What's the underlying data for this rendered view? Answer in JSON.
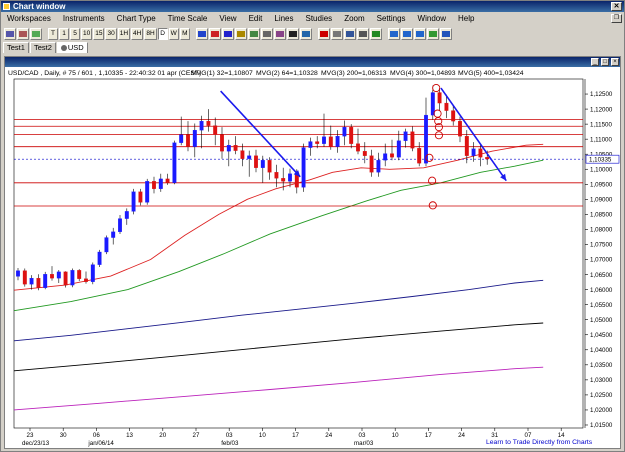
{
  "window": {
    "title": "Chart window"
  },
  "menu": [
    "Workspaces",
    "Instruments",
    "Chart Type",
    "Time Scale",
    "View",
    "Edit",
    "Lines",
    "Studies",
    "Zoom",
    "Settings",
    "Window",
    "Help"
  ],
  "toolbar": {
    "timeframes": [
      "T",
      "1",
      "5",
      "10",
      "15",
      "30",
      "1H",
      "4H",
      "8H",
      "D",
      "W",
      "M"
    ],
    "active_timeframe": "D"
  },
  "tabs": [
    "Test1",
    "Test2",
    "USD"
  ],
  "active_tab": "USD",
  "chart_info": {
    "symbol": "USD/CAD , Daily, # 75 / 601 , 1,10335 - 22:40:32 01 apr (CEST)",
    "mvg1": "MVG(1) 32=1,10807",
    "mvg2": "MVG(2) 64=1,10328",
    "mvg3": "MVG(3) 200=1,06313",
    "mvg4": "MVG(4) 300=1,04893",
    "mvg5": "MVG(5) 400=1,03424"
  },
  "footer_link": "Learn to Trade Directly from Charts",
  "colors": {
    "mvg1": "#dd2222",
    "mvg2": "#229922",
    "mvg3": "#1a1a8a",
    "mvg4": "#000000",
    "mvg5": "#bb22bb",
    "bull": "#1a1aff",
    "bear": "#dd1111",
    "hline": "#cc0000",
    "current_price": "#0000cc",
    "trendline": "#1a1aee"
  },
  "chart_data": {
    "type": "candlestick",
    "instrument": "USD/CAD",
    "timeframe": "Daily",
    "current_price": "1,10335",
    "y_ticks": [
      "1,12500",
      "1,12000",
      "1,11500",
      "1,11000",
      "1,10500",
      "1,10000",
      "1,09500",
      "1,09000",
      "1,08500",
      "1,08000",
      "1,07500",
      "1,07000",
      "1,06500",
      "1,06000",
      "1,05500",
      "1,05000",
      "1,04500",
      "1,04000",
      "1,03500",
      "1,03000",
      "1,02500",
      "1,02000",
      "1,01500"
    ],
    "x_ticks": [
      "23",
      "30",
      "06",
      "13",
      "20",
      "27",
      "03",
      "10",
      "17",
      "24",
      "03",
      "10",
      "17",
      "24",
      "31",
      "07",
      "14"
    ],
    "x_month_labels": [
      {
        "label": "dec/23/13",
        "at": 0
      },
      {
        "label": "jan/06/14",
        "at": 2
      },
      {
        "label": "feb/03",
        "at": 6
      },
      {
        "label": "mar/03",
        "at": 10
      }
    ],
    "ylim": [
      1.014,
      1.13
    ],
    "horizontal_lines": [
      1.1165,
      1.1143,
      1.1116,
      1.1075,
      1.0955,
      1.0878
    ],
    "candles": [
      [
        1.0644,
        1.0672,
        1.0631,
        1.0663
      ],
      [
        1.0663,
        1.067,
        1.061,
        1.0618
      ],
      [
        1.0618,
        1.0648,
        1.06,
        1.0638
      ],
      [
        1.0638,
        1.0651,
        1.0598,
        1.0606
      ],
      [
        1.0606,
        1.0659,
        1.0601,
        1.0651
      ],
      [
        1.0651,
        1.0678,
        1.063,
        1.0638
      ],
      [
        1.0638,
        1.0665,
        1.0622,
        1.0659
      ],
      [
        1.0659,
        1.0661,
        1.0607,
        1.0615
      ],
      [
        1.0615,
        1.067,
        1.0608,
        1.0664
      ],
      [
        1.0664,
        1.0668,
        1.0628,
        1.0636
      ],
      [
        1.0636,
        1.066,
        1.062,
        1.0626
      ],
      [
        1.0626,
        1.069,
        1.0618,
        1.0683
      ],
      [
        1.0683,
        1.0732,
        1.0675,
        1.0725
      ],
      [
        1.0725,
        1.078,
        1.0718,
        1.0773
      ],
      [
        1.0773,
        1.0805,
        1.075,
        1.0792
      ],
      [
        1.0792,
        1.0848,
        1.0785,
        1.0836
      ],
      [
        1.0836,
        1.087,
        1.0815,
        1.086
      ],
      [
        1.086,
        1.0935,
        1.085,
        1.0925
      ],
      [
        1.0925,
        1.0935,
        1.088,
        1.089
      ],
      [
        1.089,
        1.0968,
        1.0882,
        1.096
      ],
      [
        1.096,
        1.0975,
        1.092,
        1.0935
      ],
      [
        1.0935,
        1.0985,
        1.0925,
        1.0968
      ],
      [
        1.0968,
        1.0985,
        1.0948,
        1.0955
      ],
      [
        1.0955,
        1.1095,
        1.095,
        1.1088
      ],
      [
        1.1088,
        1.1175,
        1.108,
        1.1115
      ],
      [
        1.1115,
        1.116,
        1.106,
        1.1075
      ],
      [
        1.1075,
        1.1152,
        1.104,
        1.113
      ],
      [
        1.113,
        1.1178,
        1.107,
        1.116
      ],
      [
        1.116,
        1.12,
        1.1125,
        1.1145
      ],
      [
        1.1145,
        1.1172,
        1.108,
        1.1115
      ],
      [
        1.1115,
        1.114,
        1.1035,
        1.106
      ],
      [
        1.106,
        1.1098,
        1.101,
        1.108
      ],
      [
        1.108,
        1.111,
        1.105,
        1.1062
      ],
      [
        1.1062,
        1.1085,
        1.101,
        1.1035
      ],
      [
        1.1035,
        1.1062,
        1.0975,
        1.1045
      ],
      [
        1.1045,
        1.1065,
        1.099,
        1.1005
      ],
      [
        1.1005,
        1.1045,
        1.0955,
        1.103
      ],
      [
        1.103,
        1.104,
        1.0965,
        1.099
      ],
      [
        1.099,
        1.1015,
        1.094,
        1.097
      ],
      [
        1.097,
        1.1005,
        1.093,
        1.096
      ],
      [
        1.096,
        1.1002,
        1.094,
        1.0985
      ],
      [
        1.0985,
        1.1,
        1.092,
        1.094
      ],
      [
        1.094,
        1.1085,
        1.0925,
        1.1072
      ],
      [
        1.1072,
        1.1105,
        1.1045,
        1.1092
      ],
      [
        1.1092,
        1.111,
        1.107,
        1.1085
      ],
      [
        1.1085,
        1.1185,
        1.1075,
        1.1108
      ],
      [
        1.1108,
        1.1145,
        1.1065,
        1.1075
      ],
      [
        1.1075,
        1.113,
        1.1055,
        1.111
      ],
      [
        1.111,
        1.1162,
        1.108,
        1.114
      ],
      [
        1.114,
        1.115,
        1.107,
        1.1085
      ],
      [
        1.1085,
        1.1135,
        1.105,
        1.106
      ],
      [
        1.106,
        1.109,
        1.102,
        1.1045
      ],
      [
        1.1045,
        1.1065,
        1.0975,
        1.099
      ],
      [
        1.099,
        1.1055,
        1.0975,
        1.103
      ],
      [
        1.103,
        1.1085,
        1.101,
        1.1052
      ],
      [
        1.1052,
        1.1098,
        1.103,
        1.104
      ],
      [
        1.104,
        1.1128,
        1.103,
        1.1095
      ],
      [
        1.1095,
        1.1135,
        1.1072,
        1.1125
      ],
      [
        1.1125,
        1.1142,
        1.106,
        1.107
      ],
      [
        1.107,
        1.109,
        1.101,
        1.102
      ],
      [
        1.102,
        1.1238,
        1.101,
        1.118
      ],
      [
        1.118,
        1.1278,
        1.1165,
        1.1255
      ],
      [
        1.1255,
        1.127,
        1.1195,
        1.122
      ],
      [
        1.122,
        1.1248,
        1.117,
        1.1195
      ],
      [
        1.1195,
        1.1212,
        1.1145,
        1.116
      ],
      [
        1.116,
        1.1175,
        1.109,
        1.111
      ],
      [
        1.111,
        1.113,
        1.102,
        1.1045
      ],
      [
        1.1045,
        1.109,
        1.1025,
        1.1068
      ],
      [
        1.1068,
        1.108,
        1.101,
        1.104
      ],
      [
        1.104,
        1.1062,
        1.1015,
        1.1034
      ]
    ],
    "mvg1_points": [
      [
        0,
        1.0598
      ],
      [
        0.09,
        1.0615
      ],
      [
        0.17,
        1.0645
      ],
      [
        0.24,
        1.07
      ],
      [
        0.3,
        1.078
      ],
      [
        0.36,
        1.085
      ],
      [
        0.41,
        1.09
      ],
      [
        0.46,
        1.0935
      ],
      [
        0.52,
        1.0965
      ],
      [
        0.56,
        1.099
      ],
      [
        0.61,
        1.1005
      ],
      [
        0.66,
        1.1
      ],
      [
        0.72,
        1.1005
      ],
      [
        0.78,
        1.103
      ],
      [
        0.84,
        1.106
      ],
      [
        0.9,
        1.108
      ],
      [
        0.93,
        1.1083
      ]
    ],
    "mvg2_points": [
      [
        0,
        1.053
      ],
      [
        0.1,
        1.056
      ],
      [
        0.2,
        1.06
      ],
      [
        0.29,
        1.066
      ],
      [
        0.37,
        1.072
      ],
      [
        0.45,
        1.0785
      ],
      [
        0.54,
        1.0845
      ],
      [
        0.62,
        1.0895
      ],
      [
        0.68,
        1.093
      ],
      [
        0.75,
        1.0955
      ],
      [
        0.82,
        1.099
      ],
      [
        0.88,
        1.101
      ],
      [
        0.93,
        1.103
      ]
    ],
    "mvg3_points": [
      [
        0,
        1.043
      ],
      [
        0.1,
        1.0448
      ],
      [
        0.2,
        1.047
      ],
      [
        0.3,
        1.0492
      ],
      [
        0.4,
        1.0515
      ],
      [
        0.5,
        1.0535
      ],
      [
        0.6,
        1.0555
      ],
      [
        0.7,
        1.0577
      ],
      [
        0.8,
        1.06
      ],
      [
        0.88,
        1.0622
      ],
      [
        0.93,
        1.0631
      ]
    ],
    "mvg4_points": [
      [
        0,
        1.033
      ],
      [
        0.15,
        1.0355
      ],
      [
        0.3,
        1.0382
      ],
      [
        0.45,
        1.041
      ],
      [
        0.6,
        1.0437
      ],
      [
        0.75,
        1.0462
      ],
      [
        0.88,
        1.0483
      ],
      [
        0.93,
        1.0489
      ]
    ],
    "mvg5_points": [
      [
        0,
        1.02
      ],
      [
        0.15,
        1.0222
      ],
      [
        0.3,
        1.0245
      ],
      [
        0.45,
        1.0268
      ],
      [
        0.6,
        1.0292
      ],
      [
        0.75,
        1.0318
      ],
      [
        0.88,
        1.0337
      ],
      [
        0.93,
        1.0342
      ]
    ],
    "trendlines": [
      {
        "from": [
          29.8,
          1.126
        ],
        "to": [
          41.5,
          1.0975
        ],
        "arrow": true
      },
      {
        "from": [
          62.2,
          1.127
        ],
        "to": [
          71.8,
          1.0962
        ],
        "arrow": true
      }
    ],
    "circles": [
      [
        61.5,
        1.127
      ],
      [
        61.7,
        1.1185
      ],
      [
        61.8,
        1.116
      ],
      [
        61.9,
        1.114
      ],
      [
        61.9,
        1.1113
      ],
      [
        60.5,
        1.1038
      ],
      [
        60.9,
        1.0962
      ],
      [
        61.0,
        1.088
      ]
    ]
  }
}
